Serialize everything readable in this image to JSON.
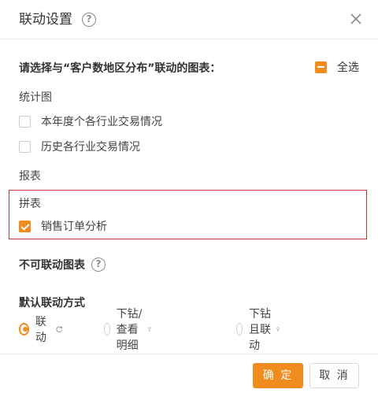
{
  "dialog": {
    "title": "联动设置",
    "prompt": "请选择与“客户数地区分布”联动的图表：",
    "select_all_label": "全选"
  },
  "sections": {
    "stats_title": "统计图",
    "stats_items": [
      {
        "label": "本年度个各行业交易情况",
        "checked": false
      },
      {
        "label": "历史各行业交易情况",
        "checked": false
      }
    ],
    "report_title": "报表",
    "pinbiao_title": "拼表",
    "pinbiao_items": [
      {
        "label": "销售订单分析",
        "checked": true
      }
    ],
    "non_linkable_title": "不可联动图表"
  },
  "link_mode": {
    "title": "默认联动方式",
    "options": [
      {
        "label": "联动",
        "selected": true,
        "icon": "link-cycle-icon"
      },
      {
        "label": "下钻/查看明细",
        "selected": false,
        "icon": "drill-down-icon"
      },
      {
        "label": "下钻且联动",
        "selected": false,
        "icon": "drill-link-icon"
      }
    ]
  },
  "footer": {
    "ok_label": "确 定",
    "cancel_label": "取 消"
  },
  "colors": {
    "accent": "#f08b1e",
    "highlight_border": "#c7333a"
  }
}
